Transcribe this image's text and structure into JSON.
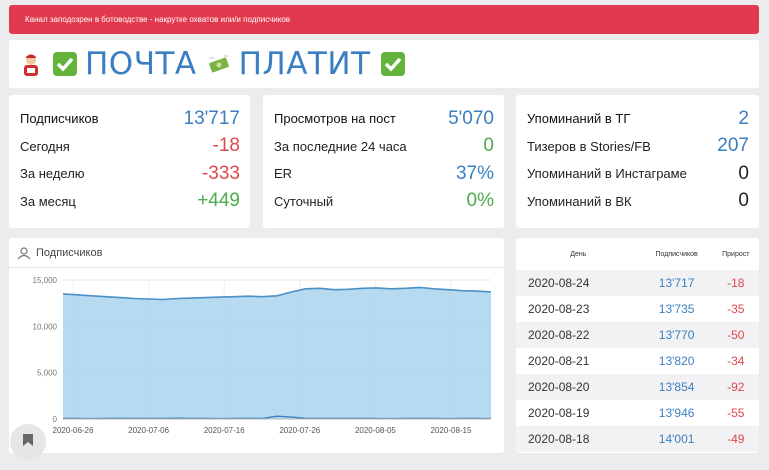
{
  "alert": {
    "text": "Канал заподозрен в ботоводстве - накрутке охватов или/и подписчиков"
  },
  "title": {
    "word1": "ПОЧТА",
    "word2": "ПЛАТИТ"
  },
  "colors": {
    "accent": "#3a7fc1",
    "negative": "#e0474c",
    "positive": "#4caa4c",
    "alert": "#e13a4e"
  },
  "stats": {
    "subscribers": [
      {
        "label": "Подписчиков",
        "value": "13'717",
        "color": "blue"
      },
      {
        "label": "Сегодня",
        "value": "-18",
        "color": "red"
      },
      {
        "label": "За неделю",
        "value": "-333",
        "color": "red"
      },
      {
        "label": "За месяц",
        "value": "+449",
        "color": "green"
      }
    ],
    "views": [
      {
        "label": "Просмотров на пост",
        "value": "5'070",
        "color": "blue"
      },
      {
        "label": "За последние 24 часа",
        "value": "0",
        "color": "green"
      },
      {
        "label": "ER",
        "value": "37%",
        "color": "blue"
      },
      {
        "label": "Суточный",
        "value": "0%",
        "color": "green"
      }
    ],
    "mentions": [
      {
        "label": "Упоминаний в ТГ",
        "value": "2",
        "color": "blue"
      },
      {
        "label": "Тизеров в Stories/FB",
        "value": "207",
        "color": "blue"
      },
      {
        "label": "Упоминаний в Инстаграме",
        "value": "0",
        "color": "dark"
      },
      {
        "label": "Упоминаний в ВК",
        "value": "0",
        "color": "dark"
      }
    ]
  },
  "chart_panel": {
    "title": "Подписчиков"
  },
  "chart_data": {
    "type": "area",
    "title": "",
    "xlabel": "",
    "ylabel": "",
    "ylim": [
      0,
      15000
    ],
    "yticks": [
      "0",
      "5,000",
      "10,000",
      "15,000"
    ],
    "xticks": [
      "2020-06-26",
      "2020-07-06",
      "2020-07-16",
      "2020-07-26",
      "2020-08-05",
      "2020-08-15"
    ],
    "grid": true,
    "series": [
      {
        "values": [
          13500,
          13400,
          13300,
          13200,
          13100,
          13000,
          12950,
          12900,
          13000,
          13050,
          13100,
          13150,
          13200,
          13250,
          13200,
          13300,
          13700,
          14050,
          14100,
          13950,
          14000,
          14100,
          14150,
          14050,
          14100,
          14200,
          14050,
          13950,
          13850,
          13800,
          13717
        ]
      },
      {
        "values": [
          50,
          60,
          40,
          70,
          80,
          60,
          50,
          70,
          90,
          60,
          50,
          40,
          60,
          80,
          70,
          300,
          200,
          80,
          60,
          50,
          70,
          60,
          50,
          40,
          60,
          70,
          50,
          40,
          60,
          50,
          40
        ]
      }
    ]
  },
  "table": {
    "headers": [
      "День",
      "Подписчиков",
      "Прирост"
    ],
    "rows": [
      {
        "date": "2020-08-24",
        "subs": "13'717",
        "growth": "-18"
      },
      {
        "date": "2020-08-23",
        "subs": "13'735",
        "growth": "-35"
      },
      {
        "date": "2020-08-22",
        "subs": "13'770",
        "growth": "-50"
      },
      {
        "date": "2020-08-21",
        "subs": "13'820",
        "growth": "-34"
      },
      {
        "date": "2020-08-20",
        "subs": "13'854",
        "growth": "-92"
      },
      {
        "date": "2020-08-19",
        "subs": "13'946",
        "growth": "-55"
      },
      {
        "date": "2020-08-18",
        "subs": "14'001",
        "growth": "-49"
      }
    ]
  }
}
